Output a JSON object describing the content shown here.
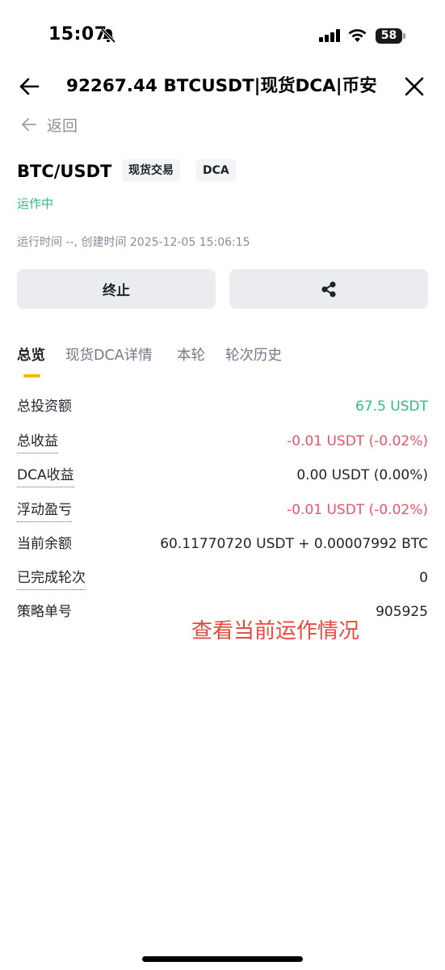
{
  "status_bar": {
    "time": "15:07",
    "battery": "58",
    "icons": [
      "bell-muted-icon",
      "signal-icon",
      "wifi-icon",
      "battery-icon"
    ]
  },
  "header": {
    "title": "92267.44 BTCUSDT|现货DCA|币安",
    "back_icon": "arrow-left-icon",
    "close_icon": "close-icon"
  },
  "sub_nav": {
    "back_label": "返回"
  },
  "bot": {
    "pair": "BTC/USDT",
    "tags": [
      "现货交易",
      "DCA"
    ],
    "status": "运作中",
    "run_info": "运行时间 --, 创建时间 2025-12-05 15:06:15"
  },
  "actions": {
    "stop_label": "终止",
    "share_icon": "share-icon"
  },
  "tabs": [
    {
      "label": "总览",
      "active": true
    },
    {
      "label": "现货DCA详情",
      "active": false
    },
    {
      "label": "本轮",
      "active": false
    },
    {
      "label": "轮次历史",
      "active": false
    }
  ],
  "overview": [
    {
      "label": "总投资额",
      "value": "67.5  USDT",
      "color": "#2ebd85"
    },
    {
      "label": "总收益",
      "value": "-0.01  USDT  (-0.02%)",
      "color": "#e8556b"
    },
    {
      "label": "DCA收益",
      "value": "0.00  USDT  (0.00%)",
      "color": "#1e2329"
    },
    {
      "label": "浮动盈亏",
      "value": "-0.01  USDT  (-0.02%)",
      "color": "#e8556b"
    },
    {
      "label": "当前余额",
      "value": "60.11770720 USDT + 0.00007992 BTC",
      "color": "#1e2329"
    },
    {
      "label": "已完成轮次",
      "value": "0",
      "color": "#1e2329"
    },
    {
      "label": "策略单号",
      "value": "905925",
      "color": "#1e2329"
    }
  ],
  "annotation": "查看当前运作情况",
  "colors": {
    "accent_yellow": "#f0b90b",
    "positive": "#2ebd85",
    "negative": "#e8556b",
    "annotation": "#e8493f"
  }
}
